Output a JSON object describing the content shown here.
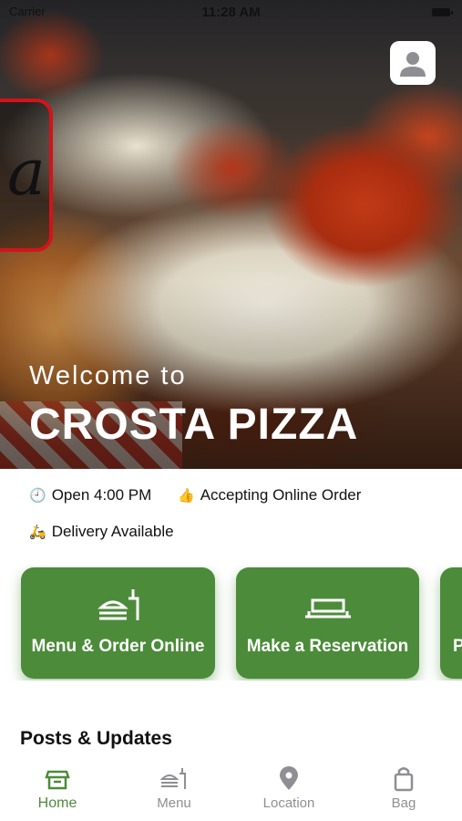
{
  "status_bar": {
    "carrier": "Carrier",
    "time": "11:28 AM"
  },
  "hero": {
    "welcome": "Welcome to",
    "restaurant_name": "CROSTA PIZZA"
  },
  "info": {
    "open": {
      "icon": "🕘",
      "text": "Open 4:00 PM"
    },
    "online_order": {
      "icon": "👍",
      "text": "Accepting Online Order"
    },
    "delivery": {
      "icon": "🛵",
      "text": "Delivery Available"
    }
  },
  "actions": [
    {
      "label": "Menu & Order Online",
      "icon": "menu-order-icon"
    },
    {
      "label": "Make a Reservation",
      "icon": "reservation-icon"
    },
    {
      "label": "P",
      "icon": "partial-card"
    }
  ],
  "sections": {
    "posts_title": "Posts & Updates"
  },
  "tabs": [
    {
      "label": "Home",
      "icon": "home-icon",
      "active": true
    },
    {
      "label": "Menu",
      "icon": "menu-icon",
      "active": false
    },
    {
      "label": "Location",
      "icon": "location-pin-icon",
      "active": false
    },
    {
      "label": "Bag",
      "icon": "bag-icon",
      "active": false
    }
  ],
  "colors": {
    "accent": "#4c8b3a",
    "inactive": "#8e8e93",
    "logo_red": "#d1141b"
  }
}
